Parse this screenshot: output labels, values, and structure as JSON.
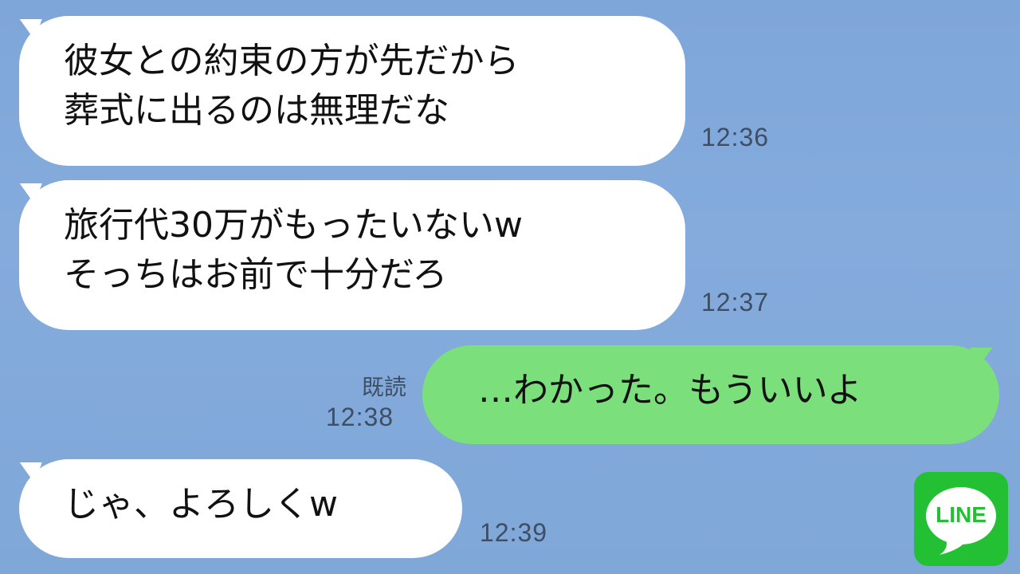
{
  "messages": [
    {
      "direction": "in",
      "lines": [
        "彼女との約束の方が先だから",
        "葬式に出るのは無理だな"
      ],
      "time": "12:36"
    },
    {
      "direction": "in",
      "lines": [
        "旅行代30万がもったいないw",
        "そっちはお前で十分だろ"
      ],
      "time": "12:37"
    },
    {
      "direction": "out",
      "lines": [
        "…わかった。もういいよ"
      ],
      "read_label": "既読",
      "time": "12:38"
    },
    {
      "direction": "in",
      "lines": [
        "じゃ、よろしくw"
      ],
      "time": "12:39"
    }
  ],
  "logo": {
    "text": "LINE",
    "icon": "line-logo-icon",
    "color": "#22c032"
  },
  "colors": {
    "background": "#84abdc",
    "incoming_bubble": "#ffffff",
    "outgoing_bubble": "#7be07b",
    "timestamp": "#3e4e64"
  }
}
